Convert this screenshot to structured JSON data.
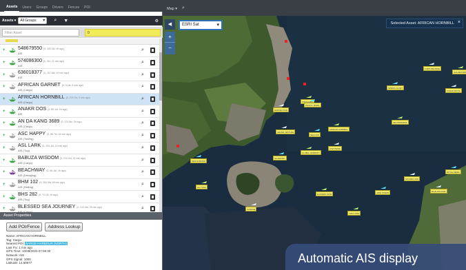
{
  "nav": {
    "tabs": [
      "Assets",
      "Users",
      "Groups",
      "Drivers",
      "Fences",
      "POI"
    ],
    "active_tab": "Assets"
  },
  "groups": {
    "label": "Assets ▾",
    "selected": "All Groups"
  },
  "filter": {
    "placeholder": "Filter Asset",
    "highlight_value": "0"
  },
  "asset_list": [
    {
      "name": "548679550",
      "meta": "(0, 150.3kt, 9h ago)",
      "type": "AIS",
      "boat_color": "#3aa244",
      "status": "+"
    },
    {
      "name": "574086300",
      "meta": "(0, 0kt, 21 min ago)",
      "type": "AIS",
      "boat_color": "#3aa244",
      "status": "+"
    },
    {
      "name": "636018377",
      "meta": "(0, 107.6kt, 49 min ago)",
      "type": "AIS",
      "boat_color": "#999999",
      "status": "+"
    },
    {
      "name": "AFRICAN GARNET",
      "meta": "(0, 0.1kt, 5 min ago)",
      "type": "AIS (Cargo)",
      "boat_color": "#999999",
      "status": "+"
    },
    {
      "name": "AFRICAN HORNBILL",
      "meta": "(0, 129.7kt, 2 min ago)",
      "type": "AIS (Cargo)",
      "boat_color": "#3aa244",
      "status": "+",
      "selected": true
    },
    {
      "name": "ANAKR DOS",
      "meta": "(0, 80.1kt, 4h ago)",
      "type": "AIS",
      "boat_color": "#3aa244",
      "status": "+"
    },
    {
      "name": "AN DA KANG 3689",
      "meta": "(0, 270.8kt, 3h ago)",
      "type": "AIS (Cargo)",
      "boat_color": "#3aa244",
      "status": "+"
    },
    {
      "name": "ASC HAPPY",
      "meta": "(0, 85.7kt, 24 min ago)",
      "type": "AIS (Towing)",
      "boat_color": "#999999",
      "status": "+"
    },
    {
      "name": "ASL LARK",
      "meta": "(0, 104.1kt, 14 min ago)",
      "type": "AIS (Tug)",
      "boat_color": "#999999",
      "status": "+"
    },
    {
      "name": "BABUZA WISDOM",
      "meta": "(0, 210.0kt, 22 min ago)",
      "type": "AIS (Cargo)",
      "boat_color": "#3aa244",
      "status": "+"
    },
    {
      "name": "BEACHWAY",
      "meta": "(0, 66.1kt, 4h ago)",
      "type": "AIS (Dredging)",
      "boat_color": "#7a3aa0",
      "status": "+"
    },
    {
      "name": "BHM 102",
      "meta": "(0, 251.3kt, 48 min ago)",
      "type": "AIS (Sailing)",
      "boat_color": "#999999",
      "status": "+"
    },
    {
      "name": "BHS 282",
      "meta": "(0, 74.1kt, 4h ago)",
      "type": "AIS (Tug)",
      "boat_color": "#3aa244",
      "status": "+"
    },
    {
      "name": "BLESSED SEA JOURNEY",
      "meta": "(0, 214.4kt, 25 min ago)",
      "type": "AIS (Cargo)",
      "boat_color": "#999999",
      "status": "+"
    }
  ],
  "properties": {
    "title": "Asset Properties",
    "add_button": "Add POI/Fence",
    "lookup_button": "Address Lookup",
    "lines": [
      {
        "label": "Name: AFRICAN HORNBILL",
        "hl": ""
      },
      {
        "label": "Tag: Cargo",
        "hl": ""
      },
      {
        "label": "Nearest POI: ",
        "hl": "BARGE HARBOUR (NORTH)"
      },
      {
        "label": "Last Fix: 1 min ago",
        "hl": ""
      },
      {
        "label": "GPS Time: 10/08/2023 07:08:30",
        "hl": ""
      },
      {
        "label": "Network: AIS",
        "hl": ""
      },
      {
        "label": "GPS Signal: 1000",
        "hl": ""
      },
      {
        "label": "Latitude: 14.60677",
        "hl": ""
      }
    ]
  },
  "map": {
    "menu": "Map ▾",
    "layer": "ESRI Sat",
    "selected_asset": "Selected Asset: AFRICAN HORNBILL",
    "vessel_labels": [
      "FORTUNE WAVE",
      "GOLDEN PRINCESS",
      "SPRING GLORY",
      "OCEAN ROYAL",
      "KOTA KAMIL",
      "PACIFIC JEWEL",
      "MARINE STAR",
      "AFRICAN HORNBILL",
      "SEA LION",
      "ASIA PEARL",
      "GLOBAL HARMONY",
      "SILVER BAY",
      "GOLDEN LION",
      "EASTERN STAR",
      "JADE OCEAN",
      "BLUE DOLPHIN",
      "HAI YANG",
      "NEW HORIZON",
      "SUNRISE",
      "TIAN LONG",
      "ROYAL PEARL",
      "GRAND VENTURE",
      "SEA PRINCESS"
    ]
  },
  "badge": "Automatic AIS display"
}
